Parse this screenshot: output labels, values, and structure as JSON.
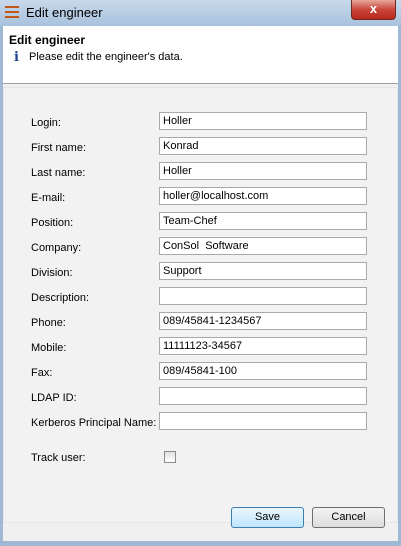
{
  "window": {
    "title": "Edit engineer",
    "close_glyph": "x"
  },
  "header": {
    "title": "Edit engineer",
    "info_icon": "i",
    "message": "Please edit the engineer's data."
  },
  "form": {
    "login": {
      "label": "Login:",
      "value": "Holler"
    },
    "first_name": {
      "label": "First name:",
      "value": "Konrad"
    },
    "last_name": {
      "label": "Last name:",
      "value": "Holler"
    },
    "email": {
      "label": "E-mail:",
      "value": "holler@localhost.com"
    },
    "position": {
      "label": "Position:",
      "value": "Team-Chef"
    },
    "company": {
      "label": "Company:",
      "value": "ConSol  Software"
    },
    "division": {
      "label": "Division:",
      "value": "Support"
    },
    "description": {
      "label": "Description:",
      "value": ""
    },
    "phone": {
      "label": "Phone:",
      "value": "089/45841-1234567"
    },
    "mobile": {
      "label": "Mobile:",
      "value": "11111123-34567"
    },
    "fax": {
      "label": "Fax:",
      "value": "089/45841-100"
    },
    "ldap_id": {
      "label": "LDAP ID:",
      "value": ""
    },
    "kerberos": {
      "label": "Kerberos Principal Name:",
      "value": ""
    },
    "track_user": {
      "label": "Track user:",
      "checked": false
    }
  },
  "buttons": {
    "save": "Save",
    "cancel": "Cancel"
  }
}
